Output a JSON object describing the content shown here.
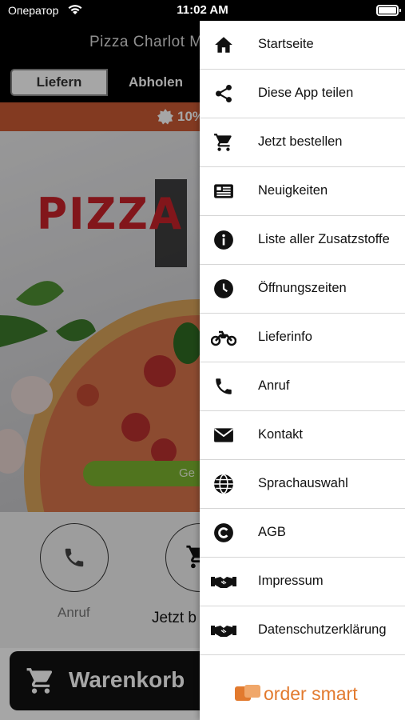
{
  "status_bar": {
    "carrier": "Оператор",
    "time": "11:02 AM"
  },
  "header": {
    "title": "Pizza Charlot M"
  },
  "tabs": [
    {
      "label": "Liefern"
    },
    {
      "label": "Abholen"
    }
  ],
  "promo": {
    "text": "10%"
  },
  "hero": {
    "logo_text": "PIZZA",
    "order_button": "Ge"
  },
  "quick_actions": [
    {
      "label": "Anruf",
      "icon": "phone-icon"
    },
    {
      "label": "Jetzt b",
      "icon": "cart-icon"
    }
  ],
  "cart": {
    "label": "Warenkorb"
  },
  "menu": {
    "items": [
      {
        "label": "Startseite",
        "icon": "home-icon"
      },
      {
        "label": "Diese App teilen",
        "icon": "share-icon"
      },
      {
        "label": "Jetzt bestellen",
        "icon": "cart-icon"
      },
      {
        "label": "Neuigkeiten",
        "icon": "news-icon"
      },
      {
        "label": "Liste aller Zusatzstoffe",
        "icon": "info-icon"
      },
      {
        "label": "Öffnungszeiten",
        "icon": "clock-icon"
      },
      {
        "label": "Lieferinfo",
        "icon": "motorcycle-icon"
      },
      {
        "label": "Anruf",
        "icon": "phone-icon"
      },
      {
        "label": "Kontakt",
        "icon": "envelope-icon"
      },
      {
        "label": "Sprachauswahl",
        "icon": "globe-icon"
      },
      {
        "label": "AGB",
        "icon": "copyright-icon"
      },
      {
        "label": "Impressum",
        "icon": "handshake-icon"
      },
      {
        "label": "Datenschutzerklärung",
        "icon": "handshake-icon"
      }
    ]
  },
  "brand": {
    "text": "order smart"
  },
  "colors": {
    "promo": "#c95a34",
    "logo_red": "#c8232a",
    "order_green": "#7bb32e",
    "brand_orange": "#e27a2e"
  }
}
